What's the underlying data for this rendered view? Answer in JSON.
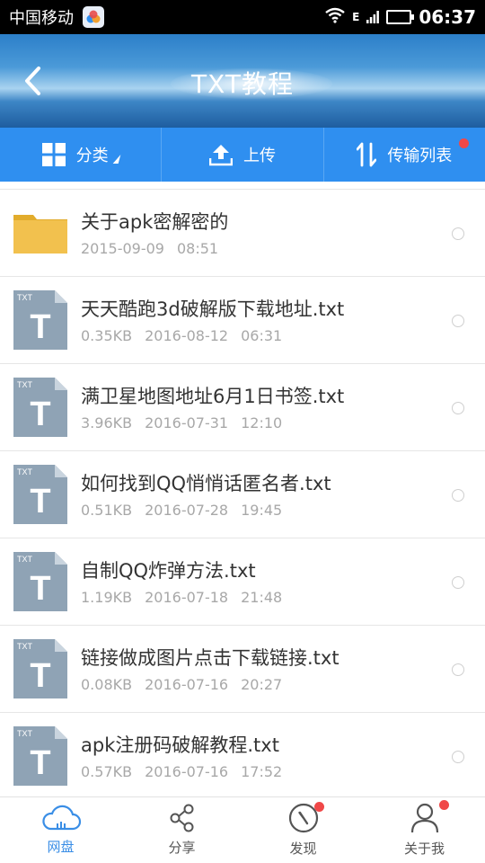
{
  "status_bar": {
    "carrier": "中国移动",
    "signal_label": "E",
    "time": "06:37",
    "battery_level": 1.0
  },
  "header": {
    "title": "TXT教程"
  },
  "toolbar": {
    "category_label": "分类",
    "upload_label": "上传",
    "transfer_label": "传输列表"
  },
  "files": [
    {
      "type": "folder",
      "name": "关于apk密解密的",
      "size": "",
      "date": "2015-09-09",
      "time": "08:51"
    },
    {
      "type": "txt",
      "name": "天天酷跑3d破解版下载地址.txt",
      "size": "0.35KB",
      "date": "2016-08-12",
      "time": "06:31"
    },
    {
      "type": "txt",
      "name": "满卫星地图地址6月1日书签.txt",
      "size": "3.96KB",
      "date": "2016-07-31",
      "time": "12:10"
    },
    {
      "type": "txt",
      "name": "如何找到QQ悄悄话匿名者.txt",
      "size": "0.51KB",
      "date": "2016-07-28",
      "time": "19:45"
    },
    {
      "type": "txt",
      "name": "自制QQ炸弹方法.txt",
      "size": "1.19KB",
      "date": "2016-07-18",
      "time": "21:48"
    },
    {
      "type": "txt",
      "name": "链接做成图片点击下载链接.txt",
      "size": "0.08KB",
      "date": "2016-07-16",
      "time": "20:27"
    },
    {
      "type": "txt",
      "name": "apk注册码破解教程.txt",
      "size": "0.57KB",
      "date": "2016-07-16",
      "time": "17:52"
    }
  ],
  "txt_icon_tag": "TXT",
  "txt_icon_letter": "T",
  "bottom_nav": {
    "items": [
      {
        "label": "网盘",
        "active": true
      },
      {
        "label": "分享",
        "active": false
      },
      {
        "label": "发现",
        "active": false
      },
      {
        "label": "关于我",
        "active": false
      }
    ]
  },
  "colors": {
    "accent": "#2f8ff0",
    "folder": "#f2c14e",
    "txt_icon": "#8fa3b5",
    "notification": "#f04848"
  }
}
